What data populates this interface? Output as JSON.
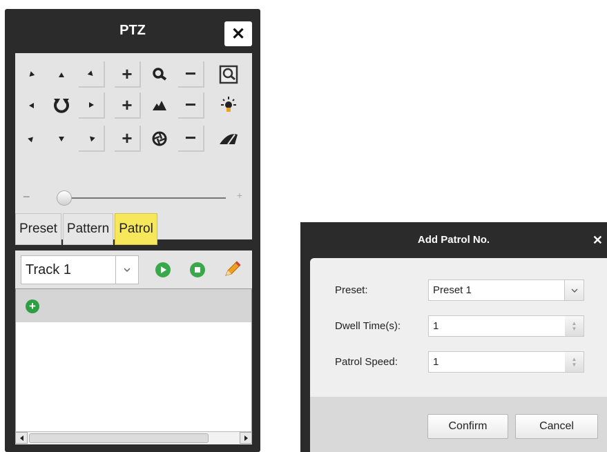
{
  "ptz_panel": {
    "title": "PTZ",
    "close_label": "✕",
    "buttons": {
      "plus": "+",
      "minus": "−"
    },
    "slider": {
      "minus": "−",
      "plus": "+",
      "level": 0.08
    },
    "tabs": [
      {
        "label": "Preset",
        "active": false
      },
      {
        "label": "Pattern",
        "active": false
      },
      {
        "label": "Patrol",
        "active": true
      }
    ],
    "track_select": {
      "value": "Track 1"
    },
    "add_label": "+"
  },
  "add_patrol_dialog": {
    "title": "Add Patrol No.",
    "close_label": "✕",
    "preset": {
      "label": "Preset:",
      "value": "Preset 1"
    },
    "dwell_time": {
      "label": "Dwell Time(s):",
      "value": "1"
    },
    "patrol_speed": {
      "label": "Patrol Speed:",
      "value": "1"
    },
    "confirm_label": "Confirm",
    "cancel_label": "Cancel"
  },
  "colors": {
    "panel_bg": "#2b2b2b",
    "active_tab": "#f7e75a",
    "play_green": "#39a84a",
    "edit_orange": "#f0a020"
  },
  "icons": [
    "arrow-up-left-icon",
    "arrow-up-icon",
    "arrow-up-right-icon",
    "arrow-left-icon",
    "auto-scan-icon",
    "arrow-right-icon",
    "arrow-down-left-icon",
    "arrow-down-icon",
    "arrow-down-right-icon",
    "zoom-icon",
    "focus-icon",
    "iris-icon",
    "3d-zoom-icon",
    "light-icon",
    "wiper-icon",
    "start-patrol-icon",
    "stop-patrol-icon",
    "edit-icon",
    "add-icon"
  ]
}
